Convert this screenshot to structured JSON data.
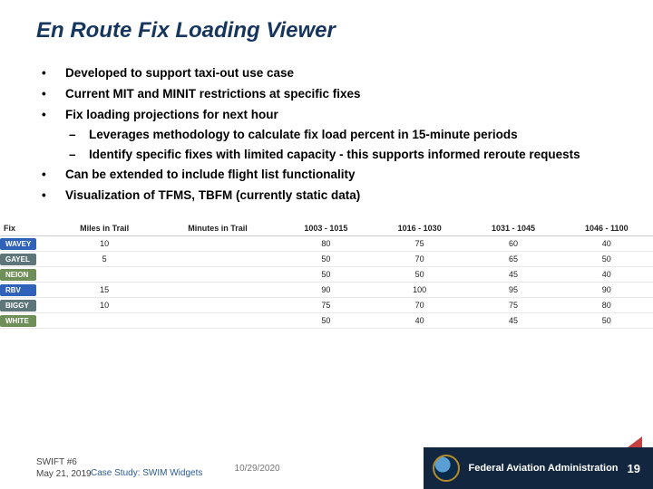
{
  "title": "En Route Fix Loading Viewer",
  "bullets": {
    "b1": "Developed to support taxi-out use case",
    "b2": "Current MIT and MINIT restrictions at specific fixes",
    "b3": "Fix loading projections for next hour",
    "b3a": "Leverages methodology to calculate fix load percent in 15-minute periods",
    "b3b": "Identify specific fixes with limited capacity - this supports informed reroute requests",
    "b4": "Can be extended to include flight list functionality",
    "b5": "Visualization of TFMS, TBFM (currently static data)"
  },
  "table": {
    "headers": {
      "h0": "Fix",
      "h1": "Miles in Trail",
      "h2": "Minutes in Trail",
      "h3": "1003 - 1015",
      "h4": "1016 - 1030",
      "h5": "1031 - 1045",
      "h6": "1046 - 1100"
    },
    "rows": [
      {
        "fix": "WAVEY",
        "color": "#2f62b8",
        "mit": "10",
        "minit": "",
        "c1": "80",
        "c2": "75",
        "c3": "60",
        "c4": "40"
      },
      {
        "fix": "GAYEL",
        "color": "#5e7679",
        "mit": "5",
        "minit": "",
        "c1": "50",
        "c2": "70",
        "c3": "65",
        "c4": "50"
      },
      {
        "fix": "NEION",
        "color": "#6e8f58",
        "mit": "",
        "minit": "",
        "c1": "50",
        "c2": "50",
        "c3": "45",
        "c4": "40"
      },
      {
        "fix": "RBV",
        "color": "#2f62b8",
        "mit": "15",
        "minit": "",
        "c1": "90",
        "c2": "100",
        "c3": "95",
        "c4": "90"
      },
      {
        "fix": "BIGGY",
        "color": "#5e7679",
        "mit": "10",
        "minit": "",
        "c1": "75",
        "c2": "70",
        "c3": "75",
        "c4": "80"
      },
      {
        "fix": "WHITE",
        "color": "#6e8f58",
        "mit": "",
        "minit": "",
        "c1": "50",
        "c2": "40",
        "c3": "45",
        "c4": "50"
      }
    ]
  },
  "footer": {
    "swift": "SWIFT #6",
    "date1": "May 21, 2019",
    "overlay": "Case Study: SWIM Widgets",
    "date2": "10/29/2020",
    "agency": "Federal Aviation Administration",
    "page": "19"
  }
}
